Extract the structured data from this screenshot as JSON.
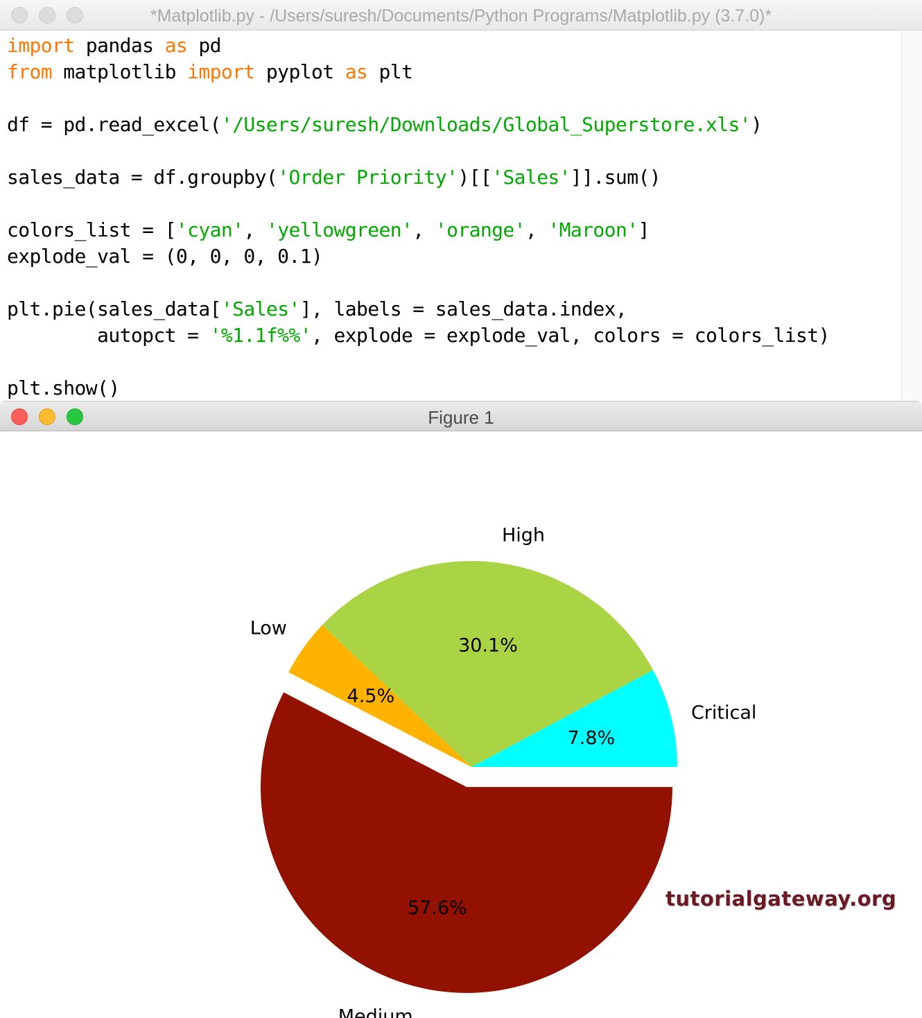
{
  "editor": {
    "title": "*Matplotlib.py - /Users/suresh/Documents/Python Programs/Matplotlib.py (3.7.0)*",
    "lines": [
      [
        {
          "t": "import",
          "c": "kw"
        },
        {
          "t": " pandas "
        },
        {
          "t": "as",
          "c": "kw"
        },
        {
          "t": " pd"
        }
      ],
      [
        {
          "t": "from",
          "c": "kw"
        },
        {
          "t": " matplotlib "
        },
        {
          "t": "import",
          "c": "kw"
        },
        {
          "t": " pyplot "
        },
        {
          "t": "as",
          "c": "kw"
        },
        {
          "t": " plt"
        }
      ],
      [],
      [
        {
          "t": "df = pd.read_excel("
        },
        {
          "t": "'/Users/suresh/Downloads/Global_Superstore.xls'",
          "c": "str"
        },
        {
          "t": ")"
        }
      ],
      [],
      [
        {
          "t": "sales_data = df.groupby("
        },
        {
          "t": "'Order Priority'",
          "c": "str"
        },
        {
          "t": ")[["
        },
        {
          "t": "'Sales'",
          "c": "str"
        },
        {
          "t": "]].sum()"
        }
      ],
      [],
      [
        {
          "t": "colors_list = ["
        },
        {
          "t": "'cyan'",
          "c": "str"
        },
        {
          "t": ", "
        },
        {
          "t": "'yellowgreen'",
          "c": "str"
        },
        {
          "t": ", "
        },
        {
          "t": "'orange'",
          "c": "str"
        },
        {
          "t": ", "
        },
        {
          "t": "'Maroon'",
          "c": "str"
        },
        {
          "t": "]"
        }
      ],
      [
        {
          "t": "explode_val = (0, 0, 0, 0.1)"
        }
      ],
      [],
      [
        {
          "t": "plt.pie(sales_data["
        },
        {
          "t": "'Sales'",
          "c": "str"
        },
        {
          "t": "], labels = sales_data.index,"
        }
      ],
      [
        {
          "t": "        autopct = "
        },
        {
          "t": "'%1.1f%%'",
          "c": "str"
        },
        {
          "t": ", explode = explode_val, colors = colors_list)"
        }
      ],
      [],
      [
        {
          "t": "plt.show()"
        }
      ]
    ]
  },
  "figure": {
    "title": "Figure 1",
    "watermark": "tutorialgateway.org"
  },
  "chart_data": {
    "type": "pie",
    "categories": [
      "Critical",
      "High",
      "Low",
      "Medium"
    ],
    "values": [
      7.8,
      30.1,
      4.5,
      57.6
    ],
    "pct_labels": [
      "7.8%",
      "30.1%",
      "4.5%",
      "57.6%"
    ],
    "colors": [
      "#00ffff",
      "#aad444",
      "#ffb300",
      "#931100"
    ],
    "explode": [
      0,
      0,
      0,
      0.1
    ],
    "start_angle_deg": 0,
    "direction": "counterclockwise"
  }
}
